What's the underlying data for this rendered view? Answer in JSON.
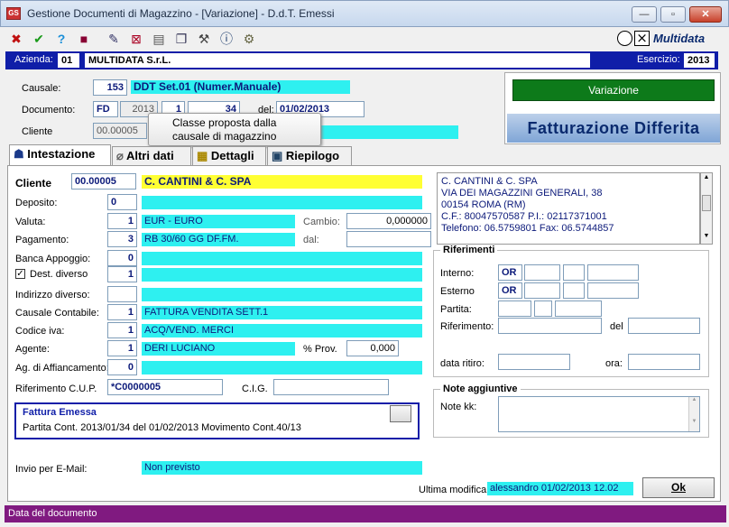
{
  "window": {
    "title": "Gestione Documenti di Magazzino - [Variazione] - D.d.T. Emessi",
    "app_icon": "app-icon",
    "minimize": "—",
    "maximize": "▫",
    "close": "✕"
  },
  "toolbar": {
    "icons": [
      "close-icon",
      "check-icon",
      "help-icon",
      "book-icon",
      "edit-icon",
      "delete-icon",
      "print-icon",
      "copy-icon",
      "tools-icon",
      "info-icon",
      "settings-icon"
    ],
    "logo": "Multidata"
  },
  "company": {
    "label": "Azienda:",
    "code": "01",
    "name": "MULTIDATA S.r.L.",
    "year_label": "Esercizio:",
    "year": "2013"
  },
  "header": {
    "causale_label": "Causale:",
    "causale_code": "153",
    "causale_desc": "DDT Set.01 (Numer.Manuale)",
    "documento_label": "Documento:",
    "doc_type": "FD",
    "doc_year": "2013",
    "doc_series": "1",
    "doc_number": "34",
    "del_label": "del:",
    "doc_date": "01/02/2013",
    "cliente_label": "Cliente",
    "cliente_code": "00.00005"
  },
  "tooltip": {
    "text_line1": "Classe proposta dalla",
    "text_line2": "causale di magazzino"
  },
  "status_panel": {
    "button": "Variazione",
    "banner": "Fatturazione Differita"
  },
  "tabs": [
    {
      "label": "Intestazione"
    },
    {
      "label": "Altri dati"
    },
    {
      "label": "Dettagli"
    },
    {
      "label": "Riepilogo"
    }
  ],
  "form": {
    "cliente_label": "Cliente",
    "cliente_code": "00.00005",
    "cliente_name": "C. CANTINI & C. SPA",
    "deposito_label": "Deposito:",
    "deposito": "0",
    "valuta_label": "Valuta:",
    "valuta_code": "1",
    "valuta_desc": "EUR - EURO",
    "cambio_label": "Cambio:",
    "cambio": "0,000000",
    "pagamento_label": "Pagamento:",
    "pagamento_code": "3",
    "pagamento_desc": "RB 30/60 GG DF.FM.",
    "dal_label": "dal:",
    "banca_label": "Banca Appoggio:",
    "banca": "0",
    "dest_label": "Dest. diverso",
    "dest_checked": "✓",
    "dest": "1",
    "indirizzo_label": "Indirizzo diverso:",
    "causale_cont_label": "Causale Contabile:",
    "causale_cont_code": "1",
    "causale_cont_desc": "FATTURA VENDITA SETT.1",
    "codice_iva_label": "Codice iva:",
    "codice_iva_code": "1",
    "codice_iva_desc": "ACQ/VEND. MERCI",
    "agente_label": "Agente:",
    "agente_code": "1",
    "agente_desc": "DERI LUCIANO",
    "prov_label": "% Prov.",
    "prov": "0,000",
    "affianc_label": "Ag. di Affiancamento:",
    "affianc": "0",
    "cup_label": "Riferimento C.U.P.",
    "cup": "*C0000005",
    "cig_label": "C.I.G."
  },
  "address": {
    "lines": [
      "C. CANTINI & C. SPA",
      "VIA DEI MAGAZZINI GENERALI, 38",
      "00154 ROMA (RM)",
      "C.F.: 80047570587 P.I.: 02117371001",
      "Telefono: 06.5759801 Fax: 06.5744857"
    ]
  },
  "riferimenti": {
    "title": "Riferimenti",
    "interno_label": "Interno:",
    "interno": "OR",
    "esterno_label": "Esterno",
    "esterno": "OR",
    "partita_label": "Partita:",
    "riferimento_label": "Riferimento:",
    "del_label": "del",
    "ritiro_label": "data ritiro:",
    "ora_label": "ora:"
  },
  "note": {
    "title": "Note aggiuntive",
    "kk_label": "Note kk:"
  },
  "fattura": {
    "title": "Fattura Emessa",
    "text": "Partita Cont. 2013/01/34 del 01/02/2013   Movimento Cont.40/13"
  },
  "email": {
    "label": "Invio per E-Mail:",
    "value": "Non previsto"
  },
  "footer": {
    "modifica_label": "Ultima modifica",
    "modifica_value": "alessandro   01/02/2013 12.02",
    "ok_label": "Ok"
  },
  "statusbar": {
    "text": "Data del documento"
  }
}
